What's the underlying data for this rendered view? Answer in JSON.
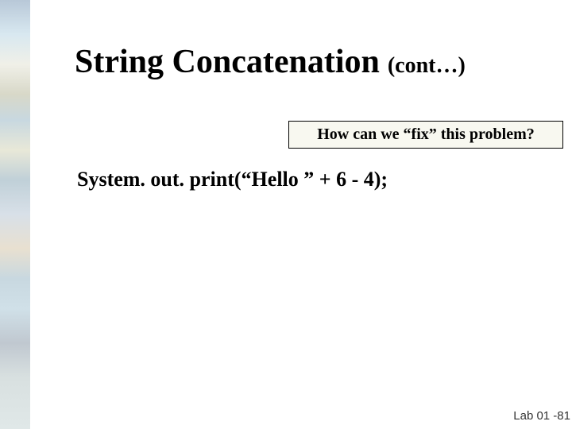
{
  "title": {
    "main": "String Concatenation",
    "sub": "(cont…)"
  },
  "callout": {
    "text": "How can we “fix” this problem?"
  },
  "code": {
    "line": "System. out. print(“Hello ” + 6 - 4);"
  },
  "footer": {
    "label": "Lab 01 -81"
  }
}
